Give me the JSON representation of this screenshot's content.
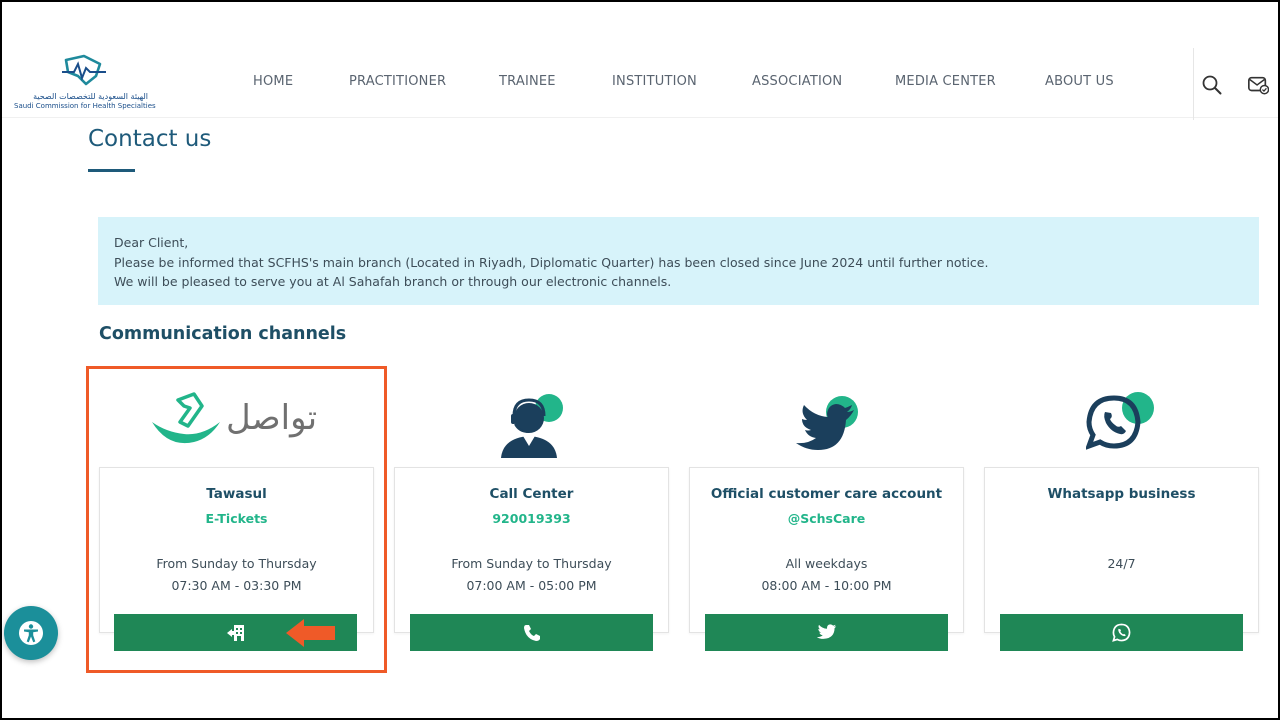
{
  "header": {
    "logo": {
      "arabic_text": "الهيئة السعودية للتخصصات الصحية",
      "english_text": "Saudi Commission for Health Specialties"
    },
    "nav": [
      {
        "label": "HOME"
      },
      {
        "label": "PRACTITIONER"
      },
      {
        "label": "TRAINEE"
      },
      {
        "label": "INSTITUTION"
      },
      {
        "label": "ASSOCIATION"
      },
      {
        "label": "MEDIA CENTER"
      },
      {
        "label": "ABOUT US"
      }
    ],
    "icons": [
      "search-icon",
      "mail-check-icon"
    ]
  },
  "page": {
    "title": "Contact us"
  },
  "notice": {
    "line1": "Dear Client,",
    "line2": "Please be informed that SCFHS's main branch (Located in Riyadh, Diplomatic Quarter) has been closed since June 2024 until further notice.",
    "line3": "We will be pleased to serve you at Al Sahafah branch or through our electronic channels."
  },
  "channels": {
    "section_title": "Communication channels",
    "items": [
      {
        "logo_text": "تواصل",
        "title": "Tawasul",
        "sub": "E-Tickets",
        "days": "From Sunday to Thursday",
        "hours": "07:30 AM - 03:30 PM",
        "button_icon": "ticket-icon"
      },
      {
        "title": "Call Center",
        "sub": "920019393",
        "days": "From Sunday to Thursday",
        "hours": "07:00 AM - 05:00 PM",
        "button_icon": "phone-icon"
      },
      {
        "title": "Official customer care account",
        "sub": "@SchsCare",
        "days": "All weekdays",
        "hours": "08:00 AM - 10:00 PM",
        "button_icon": "twitter-icon"
      },
      {
        "title": "Whatsapp business",
        "sub": "",
        "days": "24/7",
        "hours": "",
        "button_icon": "whatsapp-icon"
      }
    ]
  },
  "colors": {
    "brand_blue": "#1e5a7a",
    "accent_green": "#22b58a",
    "button_green": "#1f8756",
    "notice_bg": "#d7f3fa",
    "highlight_orange": "#ef5a28",
    "accessibility_teal": "#1b8f9a"
  },
  "accessibility": {
    "icon": "accessibility-icon"
  }
}
